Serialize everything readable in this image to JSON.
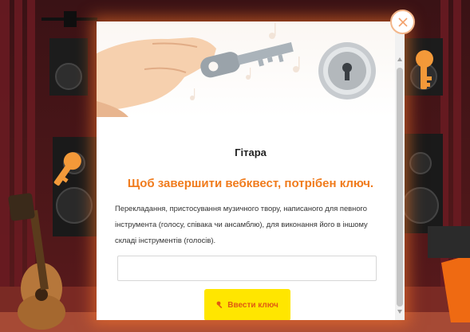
{
  "game": {
    "title": "Гітара",
    "message": "Щоб завершити вебквест, потрібен ключ.",
    "clue": "Перекладання, пристосування музичного твору, написаного для певного інструмента (голосу, співака чи ансамблю), для виконання його в іншому складі інструментів (голосів).",
    "key_input": {
      "value": "",
      "placeholder": ""
    },
    "submit_label": "Ввести ключ"
  },
  "icons": {
    "close": "close-icon",
    "submit": "key-icon",
    "banner": [
      "hand-holding-key",
      "keyhole-lock-icon"
    ]
  },
  "colors": {
    "accent_orange": "#f07b1c",
    "button_yellow": "#ffe600",
    "background_dark": "#2a0d0f"
  }
}
